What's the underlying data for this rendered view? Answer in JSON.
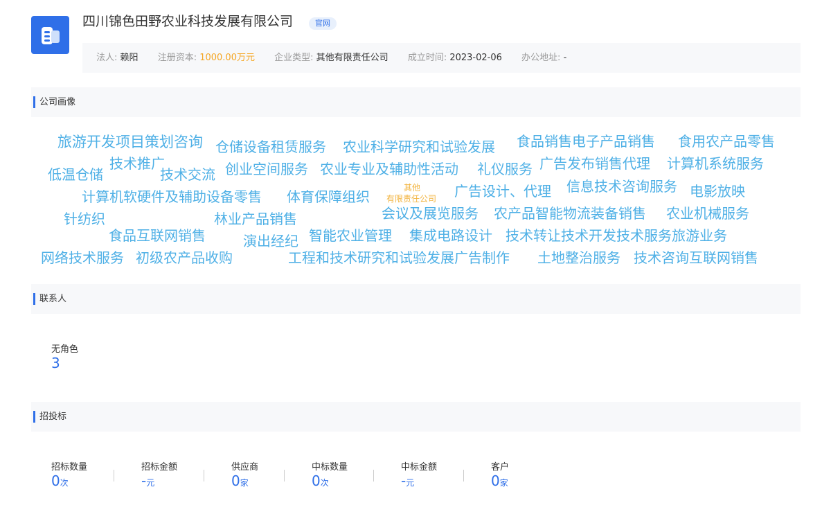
{
  "header": {
    "company_name": "四川锦色田野农业科技发展有限公司",
    "badge": "官网",
    "logo_icon": "building-icon",
    "fields": [
      {
        "label": "法人:",
        "value": "赖阳"
      },
      {
        "label": "注册资本:",
        "value": "1000.00万元"
      },
      {
        "label": "企业类型:",
        "value": "其他有限责任公司"
      },
      {
        "label": "成立时间:",
        "value": "2023-02-06"
      },
      {
        "label": "办公地址:",
        "value": "-"
      }
    ]
  },
  "portrait": {
    "title": "公司画像",
    "words": [
      "旅游开发项目策划咨询",
      "仓储设备租赁服务",
      "农业科学研究和试验发展",
      "食品销售电子产品销售",
      "食用农产品零售",
      "低温仓储",
      "技术推广",
      "技术交流",
      "创业空间服务",
      "农业专业及辅助性活动",
      "礼仪服务",
      "广告发布销售代理",
      "计算机系统服务",
      "计算机软硬件及辅助设备零售",
      "体育保障组织",
      "其他",
      "有限责任公司",
      "广告设计、代理",
      "信息技术咨询服务",
      "电影放映",
      "针纺织",
      "林业产品销售",
      "会议及展览服务",
      "农产品智能物流装备销售",
      "农业机械服务",
      "食品互联网销售",
      "演出经纪",
      "智能农业管理",
      "集成电路设计",
      "技术转让技术开发技术服务旅游业务",
      "网络技术服务",
      "初级农产品收购",
      "工程和技术研究和试验发展广告制作",
      "土地整治服务",
      "技术咨询互联网销售"
    ]
  },
  "contacts": {
    "title": "联系人",
    "stat": {
      "label": "无角色",
      "value": "3"
    }
  },
  "bidding": {
    "title": "招投标",
    "stats": [
      {
        "label": "招标数量",
        "value": "0",
        "unit": "次"
      },
      {
        "label": "招标金额",
        "value": "-",
        "unit": "元"
      },
      {
        "label": "供应商",
        "value": "0",
        "unit": "家"
      },
      {
        "label": "中标数量",
        "value": "0",
        "unit": "次"
      },
      {
        "label": "中标金额",
        "value": "-",
        "unit": "元"
      },
      {
        "label": "客户",
        "value": "0",
        "unit": "家"
      }
    ]
  }
}
